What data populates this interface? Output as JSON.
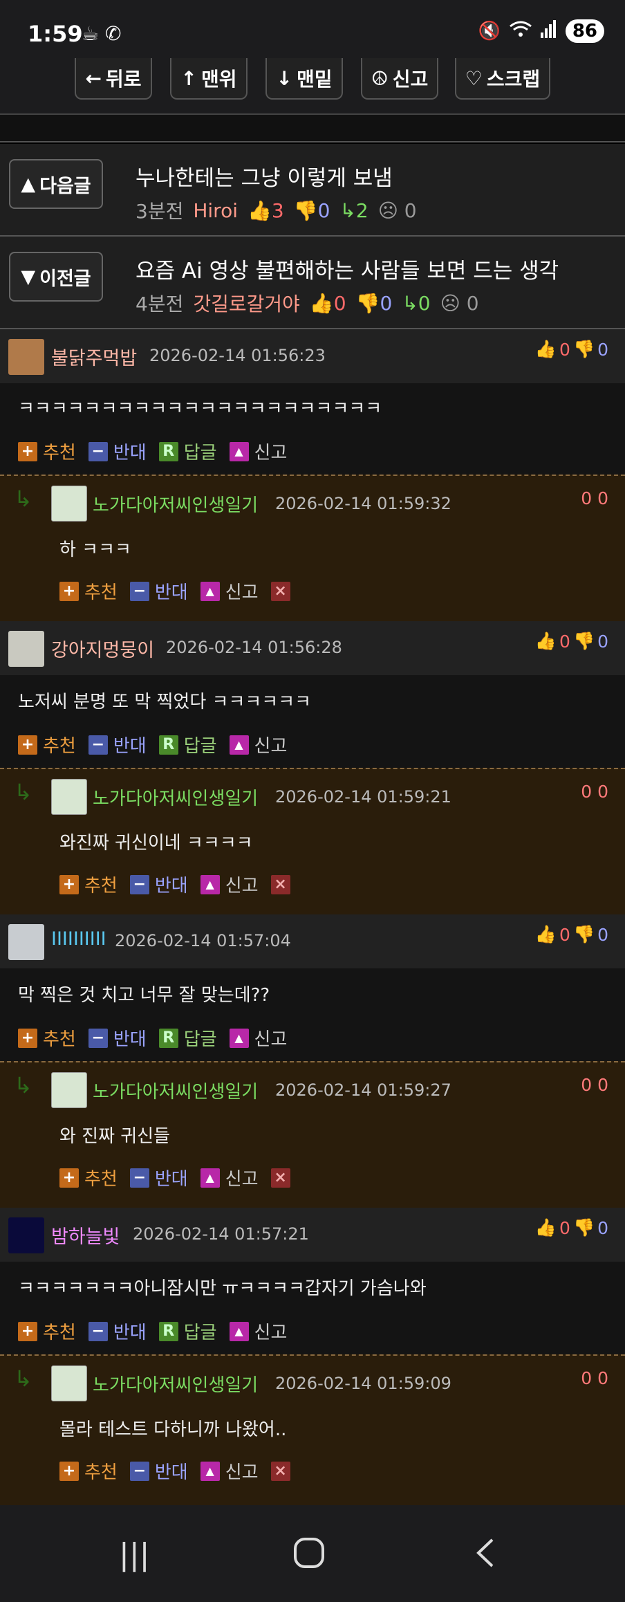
{
  "status": {
    "time": "1:59",
    "left_icons": "☕ ✆",
    "battery": "86"
  },
  "topnav": [
    {
      "arrow": "←",
      "label": "뒤로"
    },
    {
      "arrow": "↑",
      "label": "맨위"
    },
    {
      "arrow": "↓",
      "label": "맨밑"
    },
    {
      "arrow": "☮",
      "label": "신고"
    },
    {
      "arrow": "♡",
      "label": "스크랩"
    }
  ],
  "next_post": {
    "button": "다음글",
    "arrow": "▲",
    "title": "누나한테는 그냥 이렇게 보냄",
    "time": "3분전",
    "author": "Hiroi",
    "up": "3",
    "down": "0",
    "replies": "2",
    "neutral": "0"
  },
  "prev_post": {
    "button": "이전글",
    "arrow": "▼",
    "title": "요즘 Ai 영상 불편해하는 사람들 보면 드는 생각",
    "time": "4분전",
    "author": "갓길로갈거야",
    "up": "0",
    "down": "0",
    "replies": "0",
    "neutral": "0"
  },
  "actions": {
    "recommend": "추천",
    "oppose": "반대",
    "reply": "답글",
    "report": "신고"
  },
  "comments": [
    {
      "name": "불닭주먹밥",
      "date": "2026-02-14 01:56:23",
      "up": "0",
      "down": "0",
      "text": "ㅋㅋㅋㅋㅋㅋㅋㅋㅋㅋㅋㅋㅋㅋㅋㅋㅋㅋㅋㅋㅋㅋ",
      "reply": {
        "name": "노가다아저씨인생일기",
        "date": "2026-02-14 01:59:32",
        "up": "0",
        "down": "0",
        "text": "하 ㅋㅋㅋ"
      }
    },
    {
      "name": "강아지멍뭉이",
      "date": "2026-02-14 01:56:28",
      "up": "0",
      "down": "0",
      "text": "노저씨 분명 또 막 찍었다 ㅋㅋㅋㅋㅋㅋ",
      "reply": {
        "name": "노가다아저씨인생일기",
        "date": "2026-02-14 01:59:21",
        "up": "0",
        "down": "0",
        "text": "와진짜 귀신이네 ㅋㅋㅋㅋ"
      }
    },
    {
      "name": "IIIIIIIIII",
      "date": "2026-02-14 01:57:04",
      "up": "0",
      "down": "0",
      "text": "막 찍은 것 치고 너무 잘 맞는데??",
      "reply": {
        "name": "노가다아저씨인생일기",
        "date": "2026-02-14 01:59:27",
        "up": "0",
        "down": "0",
        "text": "와 진짜 귀신들"
      }
    },
    {
      "name": "밤하늘빛",
      "date": "2026-02-14 01:57:21",
      "up": "0",
      "down": "0",
      "text": "ㅋㅋㅋㅋㅋㅋㅋ아니잠시만 ㅠㅋㅋㅋㅋ갑자기 가슴나와",
      "reply": {
        "name": "노가다아저씨인생일기",
        "date": "2026-02-14 01:59:09",
        "up": "0",
        "down": "0",
        "text": "몰라 테스트 다하니까 나왔어.."
      }
    }
  ],
  "colors": {
    "reply_bg": "#2a1d0b",
    "up": "#ff6a6a",
    "down": "#9aa3ff",
    "reply_count": "#7bdc62"
  }
}
